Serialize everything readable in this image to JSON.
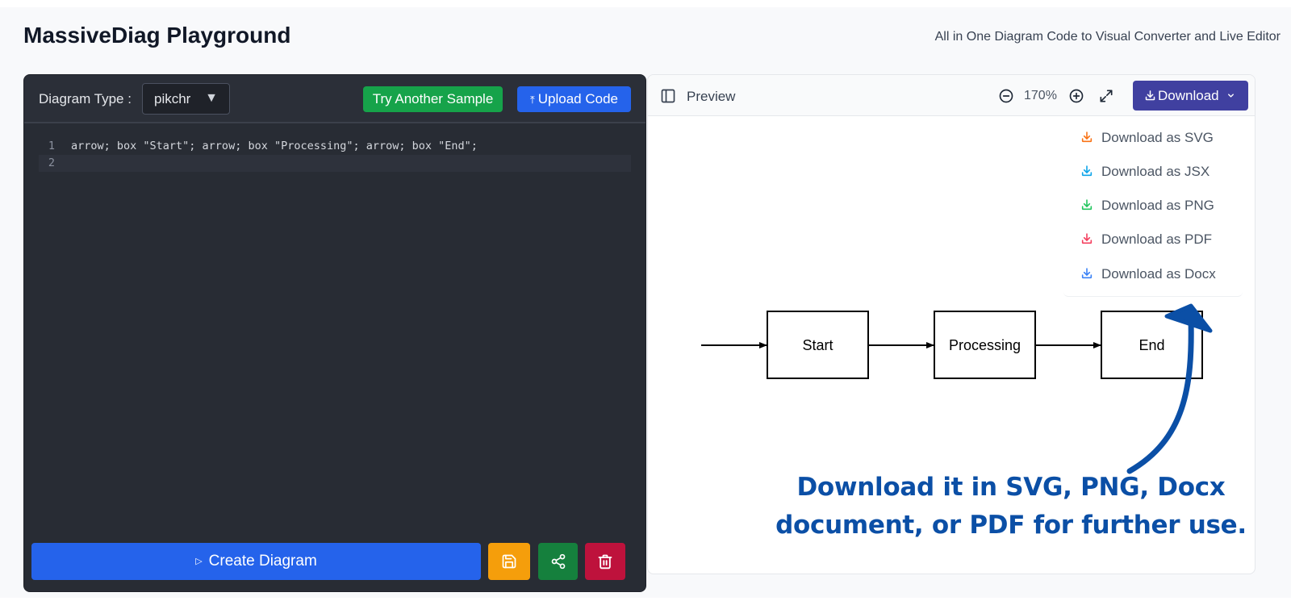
{
  "app": {
    "title": "MassiveDiag Playground",
    "subtitle": "All in One Diagram Code to Visual Converter and Live Editor"
  },
  "editor": {
    "diagram_type_label": "Diagram Type :",
    "diagram_type_value": "pikchr",
    "try_sample_label": "Try Another Sample",
    "upload_label": "Upload Code",
    "code_lines": [
      {
        "number": "1",
        "text": "arrow; box \"Start\"; arrow; box \"Processing\"; arrow; box \"End\";"
      },
      {
        "number": "2",
        "text": ""
      }
    ],
    "create_label": "Create Diagram"
  },
  "preview": {
    "title": "Preview",
    "zoom_level": "170%",
    "download_label": "Download",
    "download_menu": [
      {
        "label": "Download as SVG",
        "icon": "download-icon",
        "color": "#f97316"
      },
      {
        "label": "Download as JSX",
        "icon": "download-icon",
        "color": "#0ea5e9"
      },
      {
        "label": "Download as PNG",
        "icon": "download-icon",
        "color": "#22c55e"
      },
      {
        "label": "Download as PDF",
        "icon": "download-icon",
        "color": "#f43f5e"
      },
      {
        "label": "Download as Docx",
        "icon": "download-icon",
        "color": "#3b82f6"
      }
    ],
    "diagram_boxes": [
      "Start",
      "Processing",
      "End"
    ],
    "callout_lines": [
      "Download it in SVG, PNG, Docx",
      "document, or PDF for further use."
    ]
  },
  "colors": {
    "editor_bg": "#282c34",
    "primary_blue": "#2563eb",
    "success_green": "#16a34a",
    "download_button": "#4040a0",
    "callout_blue": "#0b4fa6"
  }
}
